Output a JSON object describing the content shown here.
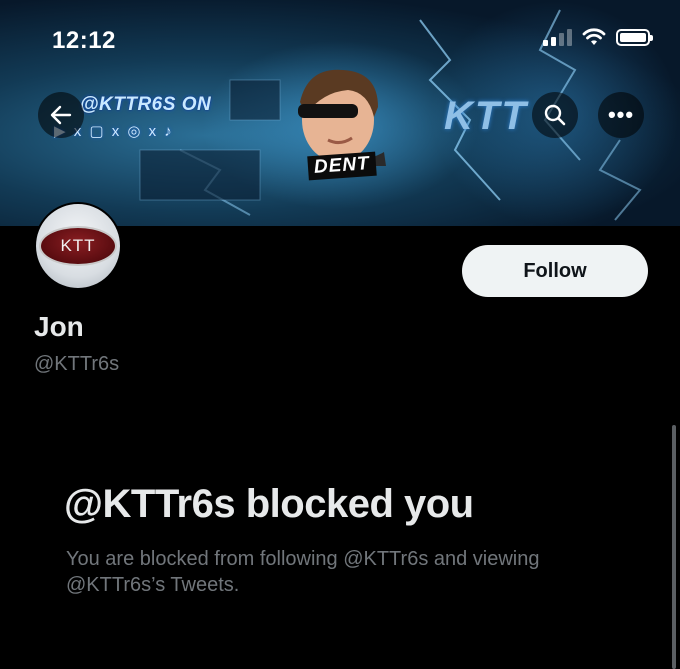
{
  "status_bar": {
    "time": "12:12"
  },
  "banner": {
    "handle_text": "@KTTR6S ON",
    "socials_text": "▶ x ▢ x ◎ x ♪",
    "face_label": "DENT",
    "logo_text": "KTT"
  },
  "header": {
    "back_icon": "arrow-left-icon",
    "search_icon": "search-icon",
    "more_icon": "more-horizontal-icon",
    "more_glyph": "•••"
  },
  "profile": {
    "avatar_text": "KTT",
    "display_name": "Jon",
    "handle": "@KTTr6s",
    "follow_label": "Follow"
  },
  "blocked": {
    "title": "@KTTr6s blocked you",
    "description": "You are blocked from following @KTTr6s and viewing @KTTr6s’s Tweets."
  },
  "colors": {
    "background": "#000000",
    "primary_text": "#e7e9ea",
    "secondary_text": "#71767b",
    "follow_bg": "#eff3f4"
  }
}
